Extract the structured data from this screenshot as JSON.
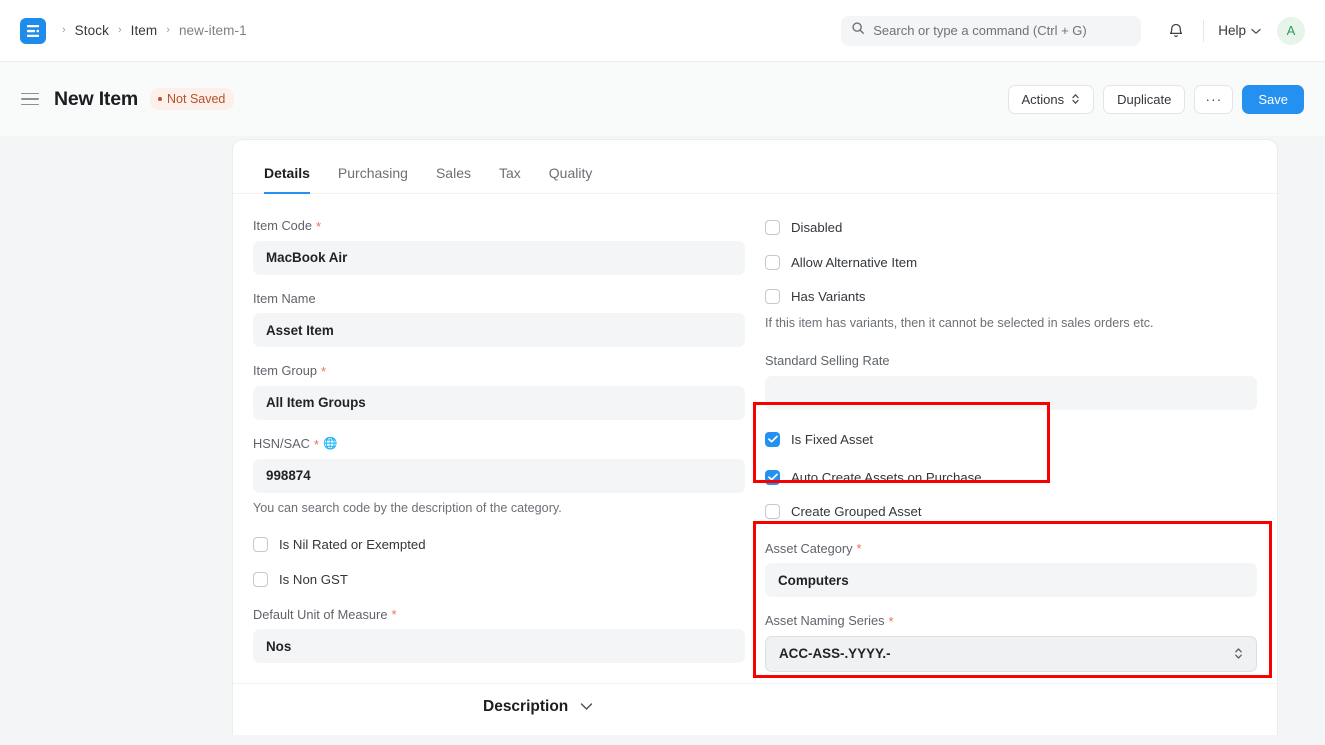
{
  "navbar": {
    "brand_icon": "erpnext-logo-icon",
    "breadcrumbs": [
      {
        "label": "Stock",
        "current": false
      },
      {
        "label": "Item",
        "current": false
      },
      {
        "label": "new-item-1",
        "current": true
      }
    ],
    "separator": "›",
    "search": {
      "placeholder": "Search or type a command (Ctrl + G)",
      "value": "",
      "icon": "search-icon"
    },
    "notifications_icon": "bell-icon",
    "help": {
      "label": "Help",
      "icon": "chevron-down-icon"
    },
    "avatar": {
      "initial": "A",
      "bg": "#e6f4ea",
      "fg": "#2e9e5b"
    }
  },
  "pagehead": {
    "menu_icon": "hamburger-icon",
    "title": "New Item",
    "status_badge": {
      "label": "Not Saved",
      "color": "#b5522c",
      "bg": "#fdf0ea"
    },
    "actions": {
      "actions_label": "Actions",
      "duplicate_label": "Duplicate",
      "more_label": "···",
      "save_label": "Save",
      "primary_color": "#2490ef"
    }
  },
  "tabs": [
    {
      "label": "Details",
      "active": true
    },
    {
      "label": "Purchasing",
      "active": false
    },
    {
      "label": "Sales",
      "active": false
    },
    {
      "label": "Tax",
      "active": false
    },
    {
      "label": "Quality",
      "active": false
    }
  ],
  "left_column": {
    "item_code": {
      "label": "Item Code",
      "required": true,
      "value": "MacBook Air"
    },
    "item_name": {
      "label": "Item Name",
      "required": false,
      "value": "Asset Item"
    },
    "item_group": {
      "label": "Item Group",
      "required": true,
      "value": "All Item Groups"
    },
    "hsn_sac": {
      "label": "HSN/SAC",
      "required": true,
      "icon": "globe-icon",
      "value": "998874",
      "help": "You can search code by the description of the category."
    },
    "is_nil_rated": {
      "label": "Is Nil Rated or Exempted",
      "checked": false
    },
    "is_non_gst": {
      "label": "Is Non GST",
      "checked": false
    },
    "default_uom": {
      "label": "Default Unit of Measure",
      "required": true,
      "value": "Nos"
    }
  },
  "right_column": {
    "disabled": {
      "label": "Disabled",
      "checked": false
    },
    "allow_alternative_item": {
      "label": "Allow Alternative Item",
      "checked": false
    },
    "has_variants": {
      "label": "Has Variants",
      "checked": false,
      "help": "If this item has variants, then it cannot be selected in sales orders etc."
    },
    "standard_selling_rate": {
      "label": "Standard Selling Rate",
      "required": false,
      "value": ""
    },
    "is_fixed_asset": {
      "label": "Is Fixed Asset",
      "checked": true
    },
    "auto_create_assets": {
      "label": "Auto Create Assets on Purchase",
      "checked": true
    },
    "create_grouped_asset": {
      "label": "Create Grouped Asset",
      "checked": false
    },
    "asset_category": {
      "label": "Asset Category",
      "required": true,
      "value": "Computers"
    },
    "asset_naming_series": {
      "label": "Asset Naming Series",
      "required": true,
      "value": "ACC-ASS-.YYYY.-",
      "icon": "stepper-icon"
    }
  },
  "description_section": {
    "title": "Description",
    "collapse_icon": "chevron-down-icon"
  },
  "annotations": {
    "color": "#f80000",
    "boxes": [
      {
        "name": "fixed-asset-group"
      },
      {
        "name": "asset-category-group"
      }
    ]
  }
}
